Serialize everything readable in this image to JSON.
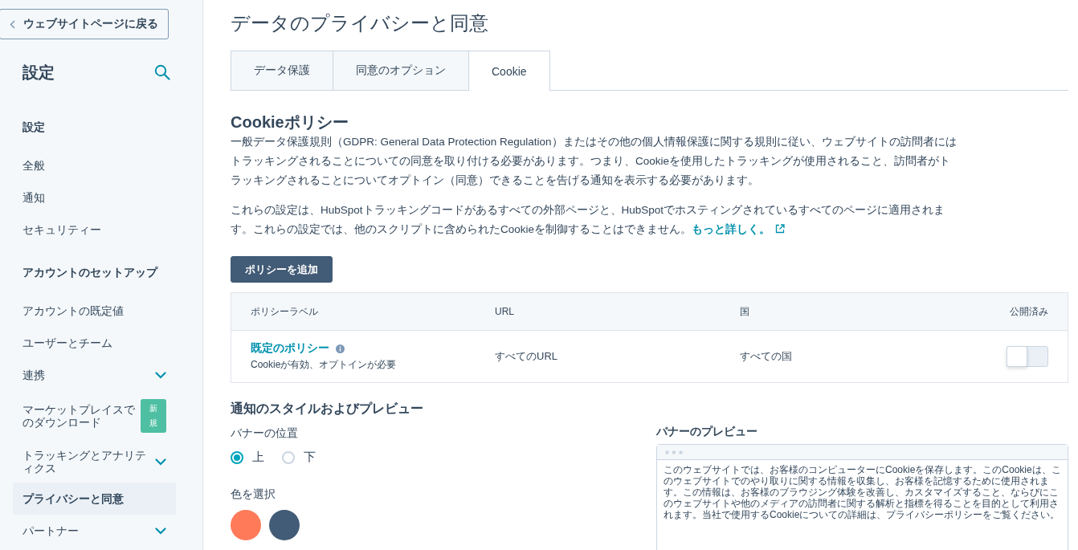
{
  "back_button": {
    "label": "ウェブサイトページに戻る"
  },
  "sidebar": {
    "title": "設定",
    "items": [
      {
        "kind": "heading",
        "label": "設定"
      },
      {
        "kind": "link",
        "label": "全般",
        "selected": false,
        "expandable": false
      },
      {
        "kind": "link",
        "label": "通知",
        "selected": false,
        "expandable": false
      },
      {
        "kind": "link",
        "label": "セキュリティー",
        "selected": false,
        "expandable": false
      },
      {
        "kind": "heading",
        "label": "アカウントのセットアップ"
      },
      {
        "kind": "link",
        "label": "アカウントの既定値",
        "selected": false,
        "expandable": false
      },
      {
        "kind": "link",
        "label": "ユーザーとチーム",
        "selected": false,
        "expandable": false
      },
      {
        "kind": "link",
        "label": "連携",
        "selected": false,
        "expandable": true
      },
      {
        "kind": "link",
        "label": "マーケットプレイスでのダウンロード",
        "selected": false,
        "expandable": false,
        "badge": "新規"
      },
      {
        "kind": "link",
        "label": "トラッキングとアナリティクス",
        "selected": false,
        "expandable": true
      },
      {
        "kind": "link",
        "label": "プライバシーと同意",
        "selected": true,
        "expandable": false
      },
      {
        "kind": "link",
        "label": "パートナー",
        "selected": false,
        "expandable": true
      }
    ]
  },
  "page": {
    "title": "データのプライバシーと同意",
    "tabs": [
      {
        "label": "データ保護",
        "selected": false
      },
      {
        "label": "同意のオプション",
        "selected": false
      },
      {
        "label": "Cookie",
        "selected": true
      }
    ]
  },
  "cookie_policy": {
    "heading": "Cookieポリシー",
    "paragraphs": [
      "一般データ保護規則（GDPR: General Data Protection Regulation）またはその他の個人情報保護に関する規則に従い、ウェブサイトの訪問者にはトラッキングされることについての同意を取り付ける必要があります。つまり、Cookieを使用したトラッキングが使用されること、訪問者がトラッキングされることについてオプトイン（同意）できることを告げる通知を表示する必要があります。",
      "これらの設定は、HubSpotトラッキングコードがあるすべての外部ページと、HubSpotでホスティングされているすべてのページに適用されます。これらの設定では、他のスクリプトに含められたCookieを制御することはできません。"
    ],
    "learn_more_link": "もっと詳しく。",
    "add_button": "ポリシーを追加",
    "table": {
      "columns": [
        "ポリシーラベル",
        "URL",
        "国",
        "公開済み"
      ],
      "rows": [
        {
          "label": "既定のポリシー",
          "description": "Cookieが有効、オプトインが必要",
          "url": "すべてのURL",
          "country": "すべての国",
          "published": false
        }
      ]
    }
  },
  "notice_style": {
    "heading": "通知のスタイルおよびプレビュー",
    "banner_position": {
      "label": "バナーの位置",
      "options": [
        {
          "label": "上",
          "selected": true
        },
        {
          "label": "下",
          "selected": false
        }
      ]
    },
    "color_picker": {
      "label": "色を選択",
      "swatches": [
        {
          "color": "#ff7a59"
        },
        {
          "color": "#425b76"
        }
      ]
    },
    "preview": {
      "label": "バナーのプレビュー",
      "banner_text": "このウェブサイトでは、お客様のコンピューターにCookieを保存します。このCookieは、このウェブサイトでのやり取りに関する情報を収集し、お客様を記憶するために使用されます。この情報は、お客様のブラウジング体験を改善し、カスタマイズすること、ならびにこのウェブサイトや他のメディアの訪問者に関する解析と指標を得ることを目的として利用されます。当社で使用するCookieについての詳細は、プライバシーポリシーをご覧ください。"
    }
  }
}
